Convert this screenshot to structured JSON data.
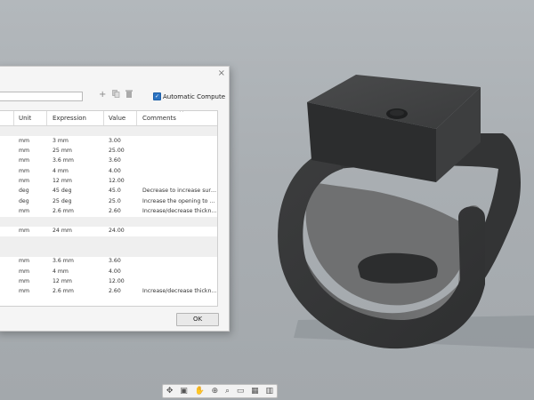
{
  "dialog": {
    "close_glyph": "×",
    "filter_value": "",
    "add_glyph": "+",
    "auto_compute_label": "Automatic Compute",
    "auto_compute_checked": true,
    "sort_glyph": "^",
    "ok_label": "OK"
  },
  "table": {
    "headers": {
      "unit": "Unit",
      "expression": "Expression",
      "value": "Value",
      "comments": "Comments"
    },
    "rows": [
      {
        "unit": "mm",
        "expression": "3 mm",
        "value": "3.00",
        "comment": ""
      },
      {
        "unit": "mm",
        "expression": "25 mm",
        "value": "25.00",
        "comment": ""
      },
      {
        "unit": "mm",
        "expression": "3.6 mm",
        "value": "3.60",
        "comment": ""
      },
      {
        "unit": "mm",
        "expression": "4 mm",
        "value": "4.00",
        "comment": ""
      },
      {
        "unit": "mm",
        "expression": "12 mm",
        "value": "12.00",
        "comment": ""
      },
      {
        "unit": "deg",
        "expression": "45 deg",
        "value": "45.0",
        "comment": "Decrease to increase surf..."
      },
      {
        "unit": "deg",
        "expression": "25 deg",
        "value": "25.0",
        "comment": "Increase the opening to ..."
      },
      {
        "unit": "mm",
        "expression": "2.6 mm",
        "value": "2.60",
        "comment": "Increase/decrease thickn..."
      },
      {
        "unit": "mm",
        "expression": "24 mm",
        "value": "24.00",
        "comment": ""
      },
      {
        "unit": "mm",
        "expression": "3.6 mm",
        "value": "3.60",
        "comment": ""
      },
      {
        "unit": "mm",
        "expression": "4 mm",
        "value": "4.00",
        "comment": ""
      },
      {
        "unit": "mm",
        "expression": "12 mm",
        "value": "12.00",
        "comment": ""
      },
      {
        "unit": "mm",
        "expression": "2.6 mm",
        "value": "2.60",
        "comment": "Increase/decrease thickn..."
      }
    ]
  },
  "toolbar": {
    "icons": [
      "orbit-icon",
      "look-at-icon",
      "pan-icon",
      "zoom-window-icon",
      "fit-icon",
      "display-settings-icon",
      "grid-settings-icon",
      "viewports-icon"
    ]
  },
  "colors": {
    "accent": "#2b73c2",
    "model": "#3a3b3c",
    "background": "#abb0b4"
  }
}
